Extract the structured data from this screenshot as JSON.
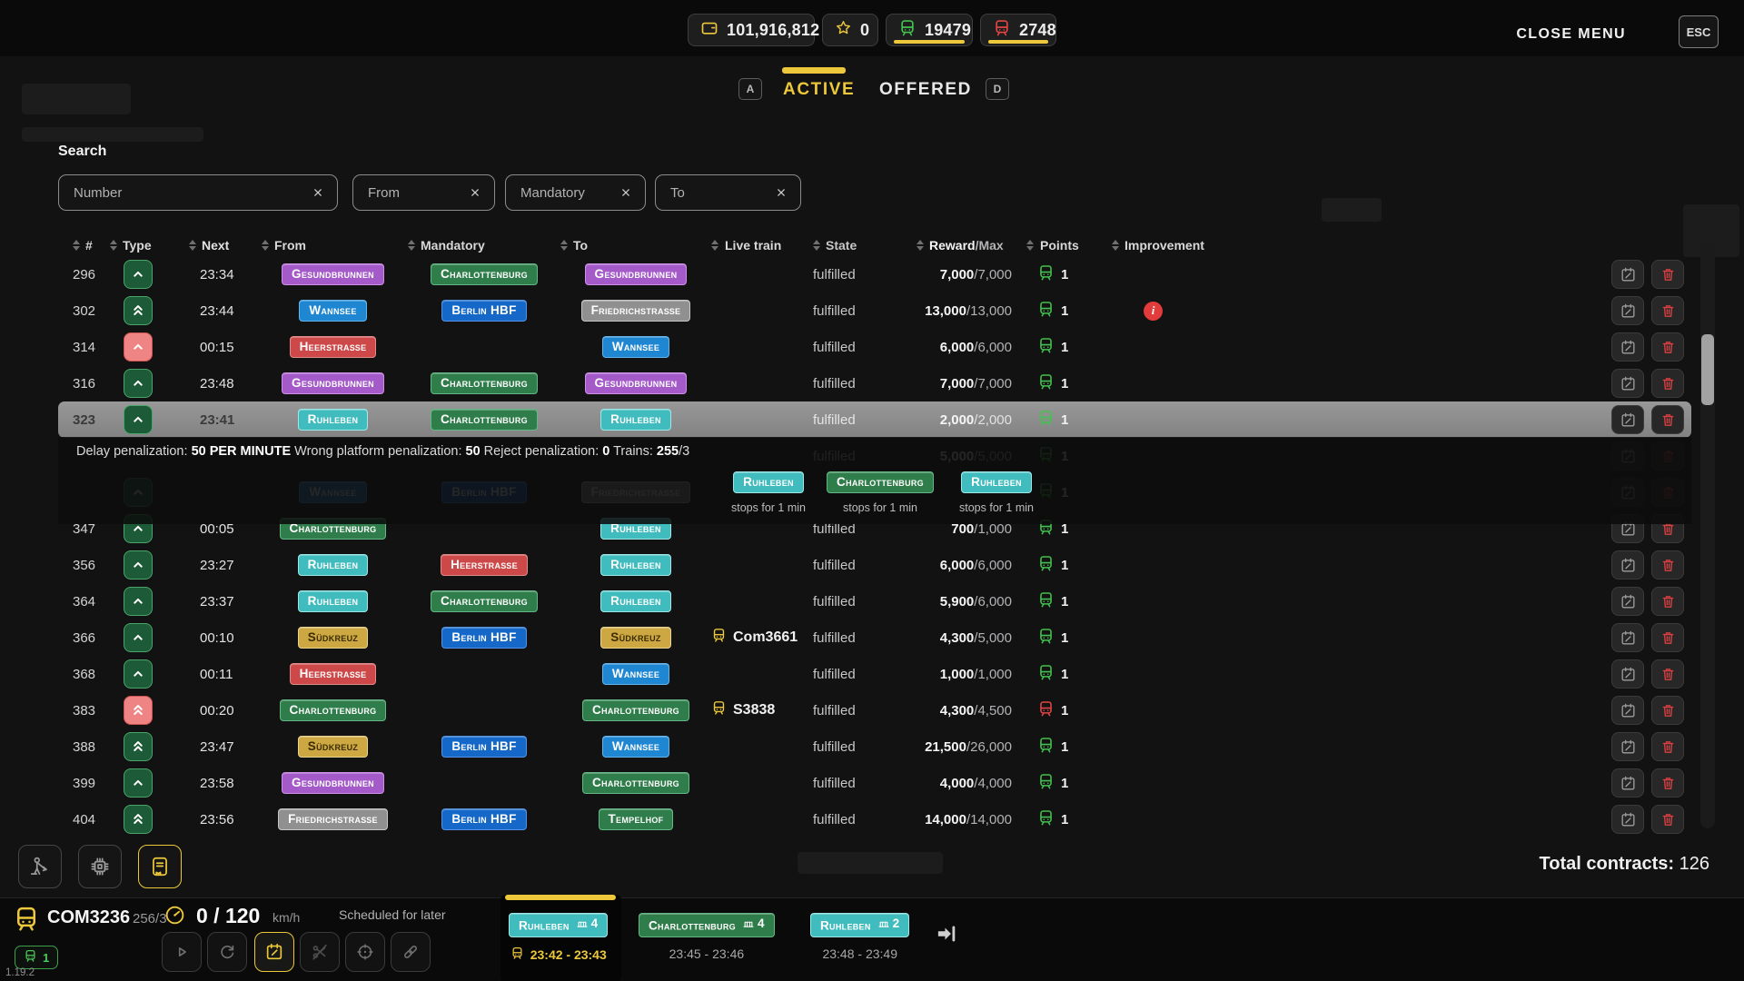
{
  "topbar": {
    "money": "101,916,812",
    "stars": "0",
    "trains_green": "19479",
    "trains_red": "2748",
    "close_menu": "CLOSE MENU",
    "esc_key": "ESC"
  },
  "tabs": {
    "active_key": "A",
    "active_label": "ACTIVE",
    "offered_label": "OFFERED",
    "offered_key": "D"
  },
  "search": {
    "label": "Search",
    "fields": [
      {
        "placeholder": "Number"
      },
      {
        "placeholder": "From"
      },
      {
        "placeholder": "Mandatory"
      },
      {
        "placeholder": "To"
      }
    ]
  },
  "colors": {
    "purple": {
      "bg": "#a45ac9",
      "bd": "#cd8fe8",
      "fg": "#ffffff"
    },
    "green": {
      "bg": "#2f7d4a",
      "bd": "#63b885",
      "fg": "#ffffff"
    },
    "blue": {
      "bg": "#1f86d2",
      "bd": "#64b5ea",
      "fg": "#ffffff"
    },
    "hbf": {
      "bg": "#1668c8",
      "bd": "#5593e0",
      "fg": "#ffffff"
    },
    "gray": {
      "bg": "#909090",
      "bd": "#c6c6c6",
      "fg": "#ffffff"
    },
    "red": {
      "bg": "#cd4949",
      "bd": "#e38a8a",
      "fg": "#ffffff"
    },
    "teal": {
      "bg": "#41bcbe",
      "bd": "#9fe8e8",
      "fg": "#ffffff"
    },
    "gold": {
      "bg": "#cda842",
      "bd": "#e8d490",
      "fg": "#3a2c00"
    },
    "accent_yellow": "#ecc83a",
    "train_green": "#42c24e",
    "train_red": "#e04545"
  },
  "table": {
    "headers": {
      "num": "#",
      "type": "Type",
      "next": "Next",
      "from": "From",
      "mandatory": "Mandatory",
      "to": "To",
      "live": "Live train",
      "state": "State",
      "reward_bold": "Reward",
      "reward_rest": "/Max",
      "points": "Points",
      "improvement": "Improvement"
    },
    "rows": [
      {
        "num": "296",
        "type": "g1",
        "next": "23:34",
        "from": {
          "t": "Gesundbrunnen",
          "c": "purple"
        },
        "mand": {
          "t": "Charlottenburg",
          "c": "green"
        },
        "to": {
          "t": "Gesundbrunnen",
          "c": "purple"
        },
        "live": "",
        "state": "fulfilled",
        "reward": "7,000",
        "max": "7,000",
        "points": "1",
        "pc": "g"
      },
      {
        "num": "302",
        "type": "g2",
        "next": "23:44",
        "from": {
          "t": "Wannsee",
          "c": "blue"
        },
        "mand": {
          "t": "Berlin HBF",
          "c": "hbf"
        },
        "to": {
          "t": "Friedrichstraße",
          "c": "gray"
        },
        "live": "",
        "state": "fulfilled",
        "reward": "13,000",
        "max": "13,000",
        "points": "1",
        "pc": "g",
        "imp": true
      },
      {
        "num": "314",
        "type": "r1",
        "next": "00:15",
        "from": {
          "t": "Heerstraße",
          "c": "red"
        },
        "mand": null,
        "to": {
          "t": "Wannsee",
          "c": "blue"
        },
        "live": "",
        "state": "fulfilled",
        "reward": "6,000",
        "max": "6,000",
        "points": "1",
        "pc": "g"
      },
      {
        "num": "316",
        "type": "g1",
        "next": "23:48",
        "from": {
          "t": "Gesundbrunnen",
          "c": "purple"
        },
        "mand": {
          "t": "Charlottenburg",
          "c": "green"
        },
        "to": {
          "t": "Gesundbrunnen",
          "c": "purple"
        },
        "live": "",
        "state": "fulfilled",
        "reward": "7,000",
        "max": "7,000",
        "points": "1",
        "pc": "g"
      },
      {
        "num": "323",
        "type": "g1",
        "next": "23:41",
        "from": {
          "t": "Ruhleben",
          "c": "teal"
        },
        "mand": {
          "t": "Charlottenburg",
          "c": "green"
        },
        "to": {
          "t": "Ruhleben",
          "c": "teal"
        },
        "live": "",
        "state": "fulfilled",
        "reward": "2,000",
        "max": "2,000",
        "points": "1",
        "pc": "g",
        "sel": true
      },
      {
        "ghost": true,
        "num": "",
        "type": "",
        "next": "",
        "from": null,
        "mand": null,
        "to": null,
        "live": "",
        "state": "fulfilled",
        "reward": "5,000",
        "max": "5,000",
        "points": "1",
        "pc": "g"
      },
      {
        "ghost": true,
        "num": "",
        "type": "g1",
        "next": "",
        "from": {
          "t": "Wannsee",
          "c": "blue"
        },
        "mand": {
          "t": "Berlin HBF",
          "c": "hbf"
        },
        "to": {
          "t": "Friedrichstraße",
          "c": "gray"
        },
        "live": "",
        "state": "",
        "reward": "",
        "max": "",
        "points": "1",
        "pc": "g"
      },
      {
        "num": "347",
        "type": "g1",
        "next": "00:05",
        "from": {
          "t": "Charlottenburg",
          "c": "green"
        },
        "mand": null,
        "to": {
          "t": "Ruhleben",
          "c": "teal"
        },
        "live": "",
        "state": "fulfilled",
        "reward": "700",
        "max": "1,000",
        "points": "1",
        "pc": "g"
      },
      {
        "num": "356",
        "type": "g1",
        "next": "23:27",
        "from": {
          "t": "Ruhleben",
          "c": "teal"
        },
        "mand": {
          "t": "Heerstraße",
          "c": "red"
        },
        "to": {
          "t": "Ruhleben",
          "c": "teal"
        },
        "live": "",
        "state": "fulfilled",
        "reward": "6,000",
        "max": "6,000",
        "points": "1",
        "pc": "g"
      },
      {
        "num": "364",
        "type": "g1",
        "next": "23:37",
        "from": {
          "t": "Ruhleben",
          "c": "teal"
        },
        "mand": {
          "t": "Charlottenburg",
          "c": "green"
        },
        "to": {
          "t": "Ruhleben",
          "c": "teal"
        },
        "live": "",
        "state": "fulfilled",
        "reward": "5,900",
        "max": "6,000",
        "points": "1",
        "pc": "g"
      },
      {
        "num": "366",
        "type": "g1",
        "next": "00:10",
        "from": {
          "t": "Südkreuz",
          "c": "gold"
        },
        "mand": {
          "t": "Berlin HBF",
          "c": "hbf"
        },
        "to": {
          "t": "Südkreuz",
          "c": "gold"
        },
        "live": "Com3661",
        "state": "fulfilled",
        "reward": "4,300",
        "max": "5,000",
        "points": "1",
        "pc": "g"
      },
      {
        "num": "368",
        "type": "g1",
        "next": "00:11",
        "from": {
          "t": "Heerstraße",
          "c": "red"
        },
        "mand": null,
        "to": {
          "t": "Wannsee",
          "c": "blue"
        },
        "live": "",
        "state": "fulfilled",
        "reward": "1,000",
        "max": "1,000",
        "points": "1",
        "pc": "g"
      },
      {
        "num": "383",
        "type": "r2",
        "next": "00:20",
        "from": {
          "t": "Charlottenburg",
          "c": "green"
        },
        "mand": null,
        "to": {
          "t": "Charlottenburg",
          "c": "green"
        },
        "live": "S3838",
        "state": "fulfilled",
        "reward": "4,300",
        "max": "4,500",
        "points": "1",
        "pc": "r"
      },
      {
        "num": "388",
        "type": "g2",
        "next": "23:47",
        "from": {
          "t": "Südkreuz",
          "c": "gold"
        },
        "mand": {
          "t": "Berlin HBF",
          "c": "hbf"
        },
        "to": {
          "t": "Wannsee",
          "c": "blue"
        },
        "live": "",
        "state": "fulfilled",
        "reward": "21,500",
        "max": "26,000",
        "points": "1",
        "pc": "g"
      },
      {
        "num": "399",
        "type": "g1",
        "next": "23:58",
        "from": {
          "t": "Gesundbrunnen",
          "c": "purple"
        },
        "mand": null,
        "to": {
          "t": "Charlottenburg",
          "c": "green"
        },
        "live": "",
        "state": "fulfilled",
        "reward": "4,000",
        "max": "4,000",
        "points": "1",
        "pc": "g"
      },
      {
        "num": "404",
        "type": "g2",
        "next": "23:56",
        "from": {
          "t": "Friedrichstraße",
          "c": "gray"
        },
        "mand": {
          "t": "Berlin HBF",
          "c": "hbf"
        },
        "to": {
          "t": "Tempelhof",
          "c": "green"
        },
        "live": "",
        "state": "fulfilled",
        "reward": "14,000",
        "max": "14,000",
        "points": "1",
        "pc": "g"
      }
    ]
  },
  "tooltip": {
    "segments": [
      {
        "t": "Delay penalization: "
      },
      {
        "t": "50 PER MINUTE",
        "b": true
      },
      {
        "t": " Wrong platform penalization: "
      },
      {
        "t": "50",
        "b": true
      },
      {
        "t": " Reject penalization: "
      },
      {
        "t": "0",
        "b": true
      },
      {
        "t": " Trains: "
      },
      {
        "t": "255",
        "b": true
      },
      {
        "t": "/3"
      }
    ]
  },
  "detail_stops": [
    {
      "station": "Ruhleben",
      "c": "teal",
      "note": "stops for 1 min"
    },
    {
      "station": "Charlottenburg",
      "c": "green",
      "note": "stops for 1 min"
    },
    {
      "station": "Ruhleben",
      "c": "teal",
      "note": "stops for 1 min"
    }
  ],
  "dock": [
    {
      "icon": "worker",
      "active": false
    },
    {
      "icon": "chip",
      "active": false
    },
    {
      "icon": "book",
      "active": true
    }
  ],
  "footer": {
    "total_label": "Total contracts:",
    "total_value": "126"
  },
  "trainbar": {
    "train_id": "COM3236",
    "train_detail": "256/3",
    "speed": "0 / 120",
    "speed_unit": "km/h",
    "status": "Scheduled for later",
    "train_count": "1",
    "version": "1.19.2",
    "controls": [
      {
        "icon": "play",
        "state": "idle"
      },
      {
        "icon": "refresh",
        "state": "idle"
      },
      {
        "icon": "calendar",
        "state": "active"
      },
      {
        "icon": "scissors",
        "state": "disabled"
      },
      {
        "icon": "target",
        "state": "idle"
      },
      {
        "icon": "link",
        "state": "idle"
      }
    ],
    "stops": [
      {
        "station": "Ruhleben",
        "c": "teal",
        "platform": "4",
        "time": "23:42 - 23:43",
        "active": true
      },
      {
        "station": "Charlottenburg",
        "c": "green",
        "platform": "4",
        "time": "23:45 - 23:46",
        "active": false
      },
      {
        "station": "Ruhleben",
        "c": "teal",
        "platform": "2",
        "time": "23:48 - 23:49",
        "active": false
      }
    ]
  }
}
